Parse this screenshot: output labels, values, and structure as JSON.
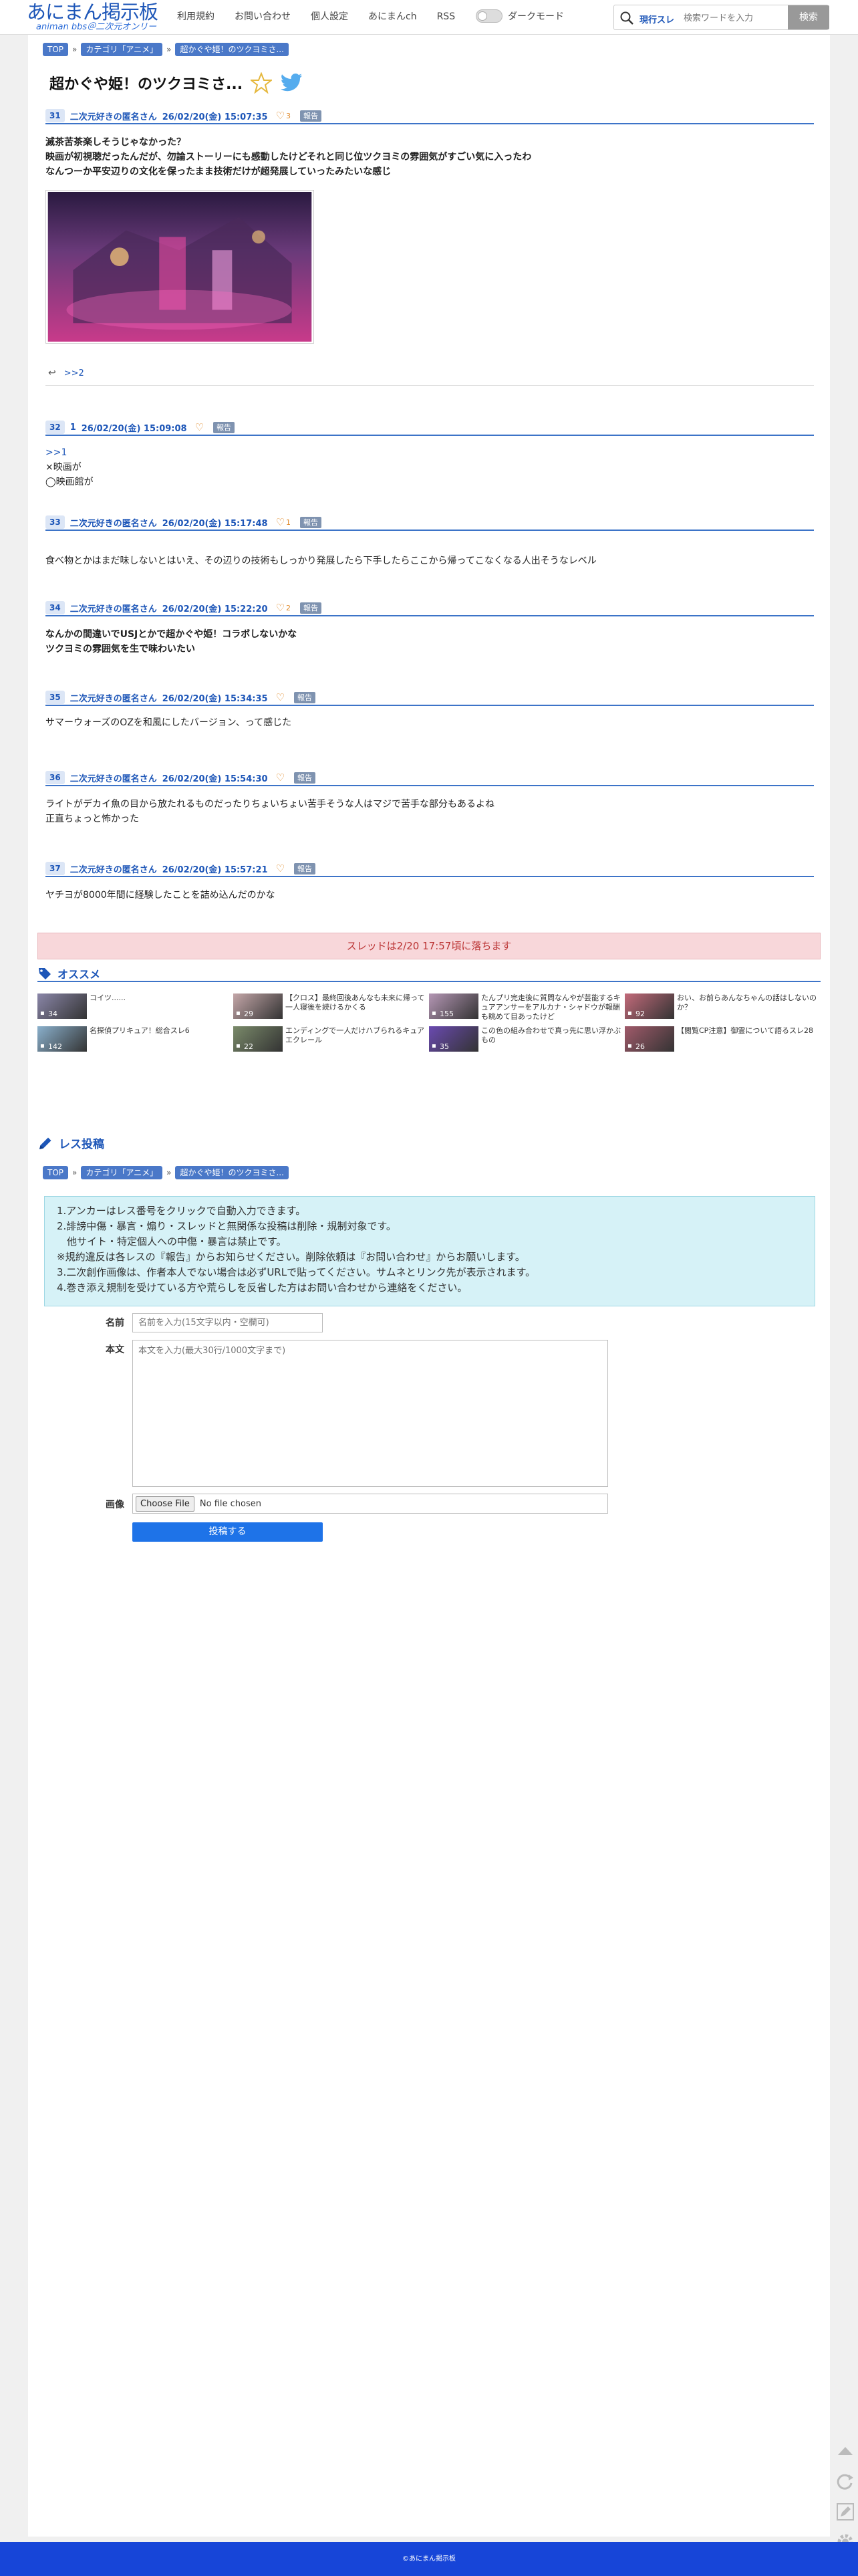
{
  "header": {
    "logo_main": "あにまん掲示板",
    "logo_sub": "animan bbs＠二次元オンリー",
    "nav": [
      "利用規約",
      "お問い合わせ",
      "個人設定",
      "あにまんch",
      "RSS"
    ],
    "dark_mode_label": "ダークモード",
    "search_scope": "現行スレ",
    "search_placeholder": "検索ワードを入力",
    "search_button": "検索"
  },
  "breadcrumb": [
    "TOP",
    "カテゴリ「アニメ」",
    "超かぐや姫！のツクヨミさ..."
  ],
  "thread_title": "超かぐや姫！のツクヨミさ...",
  "posts": [
    {
      "num": "31",
      "name": "二次元好きの匿名さん",
      "date": "26/02/20(金) 15:07:35",
      "likes": "3",
      "report": "報告",
      "lines": [
        "滅茶苦茶楽しそうじゃなかった？",
        "映画が初視聴だったんだが、勿論ストーリーにも感動したけどそれと同じ位ツクヨミの雰囲気がすごい気に入ったわ",
        "なんつーか平安辺りの文化を保ったまま技術だけが超発展していったみたいな感じ"
      ],
      "reply_link": ">>2"
    },
    {
      "num": "32",
      "name": "1",
      "date": "26/02/20(金) 15:09:08",
      "likes": "",
      "report": "報告",
      "anchor": ">>1",
      "lines": [
        "×映画が",
        "◯映画館が"
      ]
    },
    {
      "num": "33",
      "name": "二次元好きの匿名さん",
      "date": "26/02/20(金) 15:17:48",
      "likes": "1",
      "report": "報告",
      "lines": [
        "食べ物とかはまだ味しないとはいえ、その辺りの技術もしっかり発展したら下手したらここから帰ってこなくなる人出そうなレベル"
      ]
    },
    {
      "num": "34",
      "name": "二次元好きの匿名さん",
      "date": "26/02/20(金) 15:22:20",
      "likes": "2",
      "report": "報告",
      "lines": [
        "なんかの間違いでUSJとかで超かぐや姫！コラボしないかな",
        "ツクヨミの雰囲気を生で味わいたい"
      ]
    },
    {
      "num": "35",
      "name": "二次元好きの匿名さん",
      "date": "26/02/20(金) 15:34:35",
      "likes": "",
      "report": "報告",
      "lines": [
        "サマーウォーズのOZを和風にしたバージョン、って感じた"
      ]
    },
    {
      "num": "36",
      "name": "二次元好きの匿名さん",
      "date": "26/02/20(金) 15:54:30",
      "likes": "",
      "report": "報告",
      "lines": [
        "ライトがデカイ魚の目から放たれるものだったりちょいちょい苦手そうな人はマジで苦手な部分もあるよね",
        "正直ちょっと怖かった"
      ]
    },
    {
      "num": "37",
      "name": "二次元好きの匿名さん",
      "date": "26/02/20(金) 15:57:21",
      "likes": "",
      "report": "報告",
      "lines": [
        "ヤチヨが8000年間に経験したことを詰め込んだのかな"
      ]
    }
  ],
  "drop_notice": "スレッドは2/20 17:57頃に落ちます",
  "recommend": {
    "title": "オススメ",
    "items": [
      {
        "text": "コイツ......",
        "count": "34",
        "color": "#8a86a8"
      },
      {
        "text": "【クロス】最終回後あんなも未来に帰って一人寝後を続けるかくる",
        "count": "29",
        "color": "#c4a6a8"
      },
      {
        "text": "たんプリ完走後に質問なんやが芸能するキュアアンサーをアルカナ・シャドウが報酬も眺めて目あったけど",
        "count": "155",
        "color": "#b496b4"
      },
      {
        "text": "おい、お前らあんなちゃんの話はしないのか？",
        "count": "92",
        "color": "#c26a7a"
      },
      {
        "text": "名探偵プリキュア！総合スレ6",
        "count": "142",
        "color": "#8ab0cc"
      },
      {
        "text": "エンディングで一人だけハブられるキュアエクレール",
        "count": "22",
        "color": "#7a8a6a"
      },
      {
        "text": "この色の組み合わせで真っ先に思い浮かぶもの",
        "count": "35",
        "color": "#6a4ab0"
      },
      {
        "text": "【閲覧CP注意】御霊について語るスレ28",
        "count": "26",
        "color": "#a05a6a"
      }
    ]
  },
  "form": {
    "title": "レス投稿",
    "rules": [
      "1.アンカーはレス番号をクリックで自動入力できます。",
      "2.誹謗中傷・暴言・煽り・スレッドと無関係な投稿は削除・規制対象です。",
      "　他サイト・特定個人への中傷・暴言は禁止です。",
      "※規約違反は各レスの『報告』からお知らせください。削除依頼は『お問い合わせ』からお願いします。",
      "3.二次創作画像は、作者本人でない場合は必ずURLで貼ってください。サムネとリンク先が表示されます。",
      "4.巻き添え規制を受けている方や荒らしを反省した方はお問い合わせから連絡をください。"
    ],
    "name_label": "名前",
    "name_placeholder": "名前を入力(15文字以内・空欄可)",
    "body_label": "本文",
    "body_placeholder": "本文を入力(最大30行/1000文字まで)",
    "image_label": "画像",
    "file_button": "Choose File",
    "file_status": "No file chosen",
    "submit_label": "投稿する"
  },
  "footer": "©あにまん掲示板",
  "colors": {
    "brand": "#1d56b8",
    "accent": "#3d74c8",
    "footer": "#1745d8",
    "submit": "#1e73e8"
  }
}
